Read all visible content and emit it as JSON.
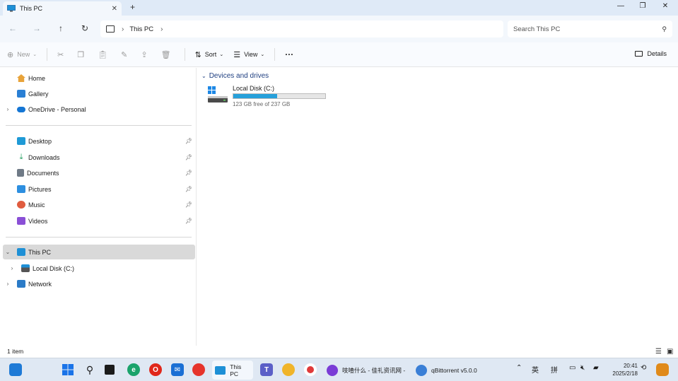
{
  "window": {
    "tab_title": "This PC",
    "tab_close": "✕",
    "new_tab": "+",
    "minimize": "—",
    "restore": "❐",
    "close": "✕"
  },
  "nav": {
    "back": "←",
    "forward": "→",
    "up": "↑",
    "refresh": "↻",
    "breadcrumb": [
      "This PC"
    ],
    "search_placeholder": "Search This PC"
  },
  "commands": {
    "new": "New",
    "sort": "Sort",
    "view": "View",
    "more": "···",
    "details": "Details"
  },
  "sidebar": {
    "top": [
      {
        "label": "Home",
        "icon": "home-icon"
      },
      {
        "label": "Gallery",
        "icon": "gallery-icon"
      },
      {
        "label": "OneDrive - Personal",
        "icon": "onedrive-icon"
      }
    ],
    "pinned": [
      {
        "label": "Desktop",
        "icon": "desktop-icon"
      },
      {
        "label": "Downloads",
        "icon": "downloads-icon"
      },
      {
        "label": "Documents",
        "icon": "documents-icon"
      },
      {
        "label": "Pictures",
        "icon": "pictures-icon"
      },
      {
        "label": "Music",
        "icon": "music-icon"
      },
      {
        "label": "Videos",
        "icon": "videos-icon"
      }
    ],
    "tree": [
      {
        "label": "This PC",
        "icon": "this-pc-icon"
      },
      {
        "label": "Local Disk (C:)",
        "icon": "drive-icon"
      },
      {
        "label": "Network",
        "icon": "network-icon"
      }
    ]
  },
  "main": {
    "group_title": "Devices and drives",
    "drives": [
      {
        "name": "Local Disk (C:)",
        "free_text": "123 GB free of 237 GB",
        "used_fraction": 0.48
      }
    ]
  },
  "status": {
    "item_count": "1 item"
  },
  "taskbar": {
    "apps": [
      {
        "label": "This PC"
      },
      {
        "label": "吱喳什么 - 佳礼资讯网 -"
      },
      {
        "label": "qBittorrent v5.0.0"
      }
    ],
    "tray": {
      "lang1": "英",
      "lang2": "拼",
      "time": "20:41",
      "date": "2025/2/18"
    }
  },
  "colors": {
    "accent": "#26a0da",
    "group_header": "#1f3f80",
    "selection": "#d9d9d9",
    "titlebar": "#dfeaf7"
  }
}
